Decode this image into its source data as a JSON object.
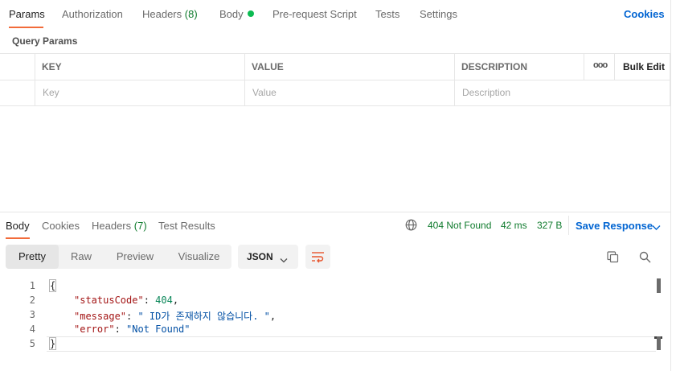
{
  "request_tabs": [
    {
      "label": "Params",
      "count": "",
      "active": true
    },
    {
      "label": "Authorization",
      "count": "",
      "active": false
    },
    {
      "label": "Headers",
      "count": "(8)",
      "active": false
    },
    {
      "label": "Body",
      "count": "",
      "active": false
    },
    {
      "label": "Pre-request Script",
      "count": "",
      "active": false
    },
    {
      "label": "Tests",
      "count": "",
      "active": false
    },
    {
      "label": "Settings",
      "count": "",
      "active": false
    }
  ],
  "cookies_link": "Cookies",
  "query_params": {
    "title": "Query Params",
    "columns": {
      "key": "KEY",
      "value": "VALUE",
      "description": "DESCRIPTION"
    },
    "more_icon": "ooo",
    "bulk_edit": "Bulk Edit",
    "placeholders": {
      "key": "Key",
      "value": "Value",
      "description": "Description"
    }
  },
  "response_tabs": [
    {
      "label": "Body",
      "count": "",
      "active": true
    },
    {
      "label": "Cookies",
      "count": "",
      "active": false
    },
    {
      "label": "Headers",
      "count": "(7)",
      "active": false
    },
    {
      "label": "Test Results",
      "count": "",
      "active": false
    }
  ],
  "response_meta": {
    "status": "404 Not Found",
    "time": "42 ms",
    "size": "327 B",
    "save_response": "Save Response"
  },
  "view_modes": [
    {
      "label": "Pretty",
      "active": true
    },
    {
      "label": "Raw",
      "active": false
    },
    {
      "label": "Preview",
      "active": false
    },
    {
      "label": "Visualize",
      "active": false
    }
  ],
  "format": "JSON",
  "code_lines": [
    {
      "n": "1",
      "text": "{"
    },
    {
      "n": "2",
      "key": "\"statusCode\"",
      "value": "404",
      "value_type": "num",
      "trail": ","
    },
    {
      "n": "3",
      "key": "\"message\"",
      "value": "\" ID가 존재하지 않습니다. \"",
      "value_type": "str",
      "trail": ","
    },
    {
      "n": "4",
      "key": "\"error\"",
      "value": "\"Not Found\"",
      "value_type": "str",
      "trail": ""
    },
    {
      "n": "5",
      "text": "}"
    }
  ],
  "colors": {
    "accent": "#f26b3a",
    "link": "#0265d2",
    "success": "#0f7b2d",
    "dot": "#0cbb52"
  },
  "icons": [
    "globe-icon",
    "chevron-down-icon",
    "wrap-lines-icon",
    "copy-icon",
    "search-icon",
    "more-icon"
  ]
}
